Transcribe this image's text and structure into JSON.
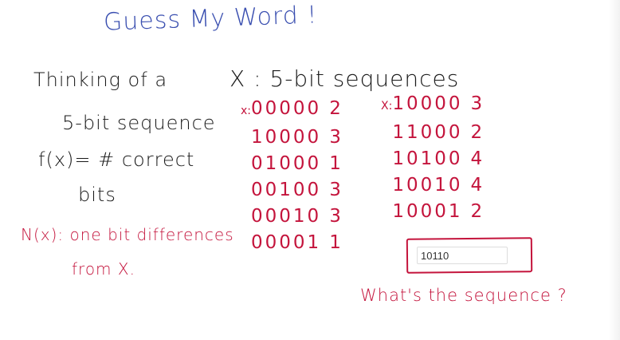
{
  "title": "Guess My Word !",
  "left_notes": {
    "line1": "Thinking of a",
    "line2": "5-bit sequence",
    "line3": "f(x)= # correct",
    "line4": "bits",
    "neighbors_line1": "N(x): one bit differences",
    "neighbors_line2": "from X."
  },
  "x_heading": "X : 5-bit sequences",
  "left_column": {
    "prefix": "x:",
    "rows": [
      {
        "seq": "00000",
        "score": "2"
      },
      {
        "seq": "10000",
        "score": "3"
      },
      {
        "seq": "01000",
        "score": "1"
      },
      {
        "seq": "00100",
        "score": "3"
      },
      {
        "seq": "00010",
        "score": "3"
      },
      {
        "seq": "00001",
        "score": "1"
      }
    ]
  },
  "right_column": {
    "prefix": "X:",
    "rows": [
      {
        "seq": "10000",
        "score": "3"
      },
      {
        "seq": "11000",
        "score": "2"
      },
      {
        "seq": "10100",
        "score": "4"
      },
      {
        "seq": "10010",
        "score": "4"
      },
      {
        "seq": "10001",
        "score": "2"
      }
    ]
  },
  "answer": {
    "value": "10110"
  },
  "question": "What's the sequence ?"
}
